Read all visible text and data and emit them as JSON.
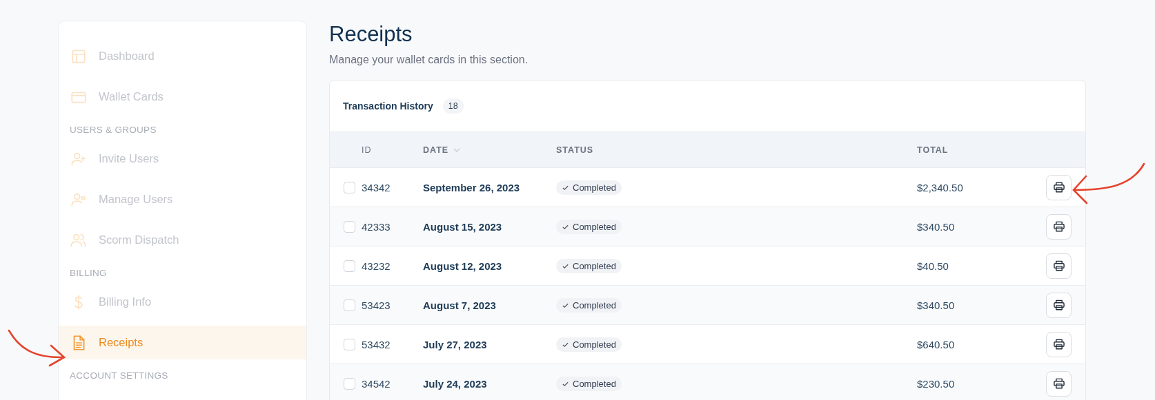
{
  "sidebar": {
    "entries": [
      {
        "kind": "item",
        "label": "Dashboard",
        "selected": false
      },
      {
        "kind": "item",
        "label": "Wallet Cards",
        "selected": false
      },
      {
        "kind": "section",
        "label": "USERS & GROUPS"
      },
      {
        "kind": "item",
        "label": "Invite Users",
        "selected": false
      },
      {
        "kind": "item",
        "label": "Manage Users",
        "selected": false
      },
      {
        "kind": "item",
        "label": "Scorm Dispatch",
        "selected": false
      },
      {
        "kind": "section",
        "label": "BILLING"
      },
      {
        "kind": "item",
        "label": "Billing Info",
        "selected": false
      },
      {
        "kind": "item",
        "label": "Receipts",
        "selected": true
      },
      {
        "kind": "section",
        "label": "ACCOUNT SETTINGS"
      }
    ]
  },
  "page": {
    "title": "Receipts",
    "subtitle": "Manage your wallet cards in this section."
  },
  "table": {
    "title": "Transaction History",
    "count": "18",
    "columns": [
      "ID",
      "DATE",
      "STATUS",
      "TOTAL"
    ],
    "rows": [
      {
        "checked": false,
        "id": "34342",
        "date": "September 26, 2023",
        "status": "Completed",
        "total": "$2,340.50"
      },
      {
        "checked": false,
        "id": "42333",
        "date": "August 15, 2023",
        "status": "Completed",
        "total": "$340.50"
      },
      {
        "checked": false,
        "id": "43232",
        "date": "August 12, 2023",
        "status": "Completed",
        "total": "$40.50"
      },
      {
        "checked": false,
        "id": "53423",
        "date": "August 7, 2023",
        "status": "Completed",
        "total": "$340.50"
      },
      {
        "checked": false,
        "id": "53432",
        "date": "July 27, 2023",
        "status": "Completed",
        "total": "$640.50"
      },
      {
        "checked": false,
        "id": "34542",
        "date": "July 24, 2023",
        "status": "Completed",
        "total": "$230.50"
      }
    ]
  }
}
